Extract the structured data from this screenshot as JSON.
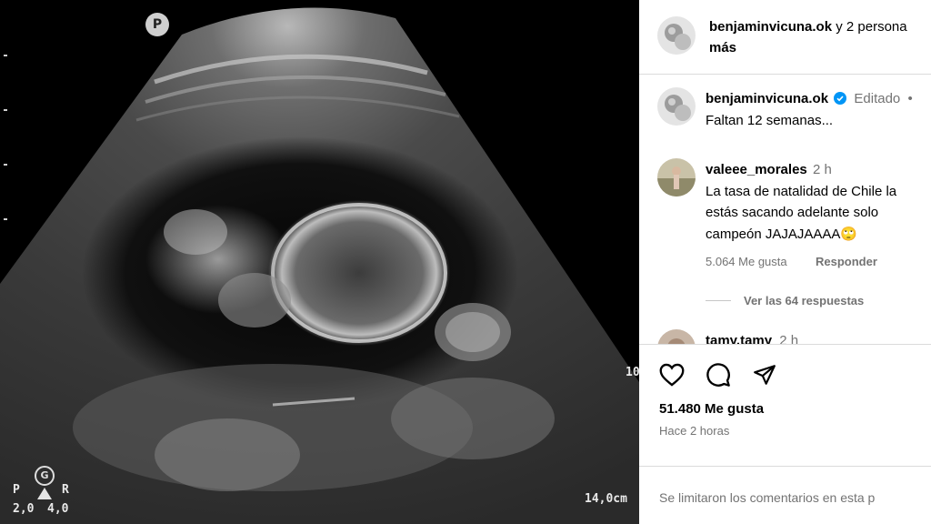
{
  "media": {
    "badge_p": "P",
    "badge_g": "G",
    "label_p": "P",
    "label_r": "R",
    "value_left": "2,0",
    "value_right": "4,0",
    "depth": "14,0cm",
    "side_mark": "10"
  },
  "post_header": {
    "username": "benjaminvicuna.ok",
    "connector": " y 2 persona",
    "more": "más"
  },
  "caption": {
    "username": "benjaminvicuna.ok",
    "edited": "Editado",
    "dot": "•",
    "text": "Faltan 12 semanas..."
  },
  "comments": [
    {
      "username": "valeee_morales",
      "time": "2 h",
      "lines": [
        "La tasa de natalidad de Chile la",
        "estás sacando adelante solo",
        "campeón JAJAJAAAA🙄"
      ],
      "likes": "5.064 Me gusta",
      "reply": "Responder",
      "view_replies": "Ver las 64 respuestas"
    },
    {
      "username": "tamy.tamy",
      "time": "2 h"
    }
  ],
  "actions": {
    "like_icon": "heart-icon",
    "comment_icon": "comment-icon",
    "share_icon": "send-icon"
  },
  "stats": {
    "likes": "51.480 Me gusta",
    "time": "Hace 2 horas"
  },
  "footer": {
    "limited": "Se limitaron los comentarios en esta p"
  }
}
